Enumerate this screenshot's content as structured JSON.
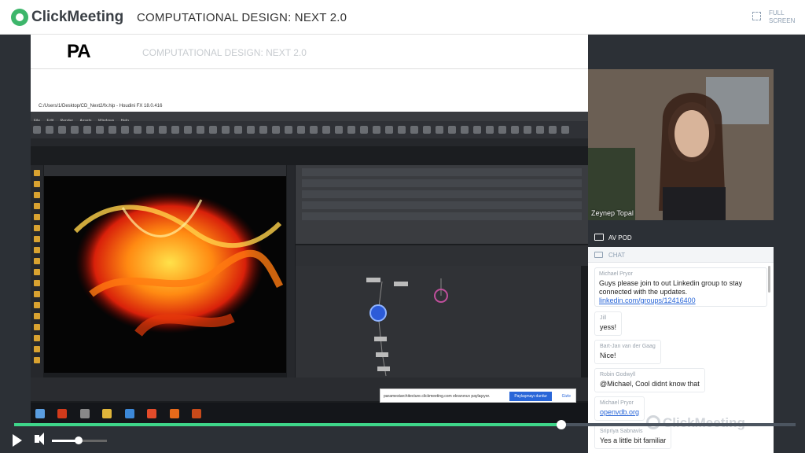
{
  "app": {
    "name": "ClickMeeting",
    "title": "COMPUTATIONAL DESIGN: NEXT 2.0"
  },
  "fullscreen": {
    "line1": "FULL",
    "line2": "SCREEN"
  },
  "slide": {
    "logo": "PA",
    "subtitle": "COMPUTATIONAL DESIGN: NEXT 2.0"
  },
  "houdini": {
    "window_title": "C:/Users/1/Desktop/CD_Next2/fx.hip - Houdini FX 18.0.416",
    "menu": [
      "File",
      "Edit",
      "Render",
      "Assets",
      "Windows",
      "Help"
    ],
    "notification": "paramestarchitecture.clickmeeting.com ekranınızı paylaşıyor.",
    "notification_button": "Paylaşmayı durdur",
    "notification_hide": "Gizle"
  },
  "camera": {
    "name": "Zeynep Topal"
  },
  "av": {
    "label": "AV POD"
  },
  "chat": {
    "label": "CHAT",
    "messages": [
      {
        "who": "Michael Pryor",
        "text": "Guys please join to out Linkedin group to stay connected with the updates.",
        "link": "linkedin.com/groups/12416400"
      },
      {
        "who": "Jill",
        "text": "yess!"
      },
      {
        "who": "Bart-Jan van der Gaag",
        "text": "Nice!"
      },
      {
        "who": "Robin Godwyll",
        "text": "@Michael, Cool didnt know that"
      },
      {
        "who": "Michael Pryor",
        "link": "openvdb.org"
      },
      {
        "who": "Sripriya Sabnavis",
        "text": "Yes a little bit familiar"
      }
    ]
  },
  "watermark": "ClickMeeting",
  "player": {
    "progress": 0.7,
    "volume": 0.48
  },
  "colors": {
    "accent": "#3ed68a",
    "brand_green": "#3db66b",
    "link": "#2966d8"
  }
}
